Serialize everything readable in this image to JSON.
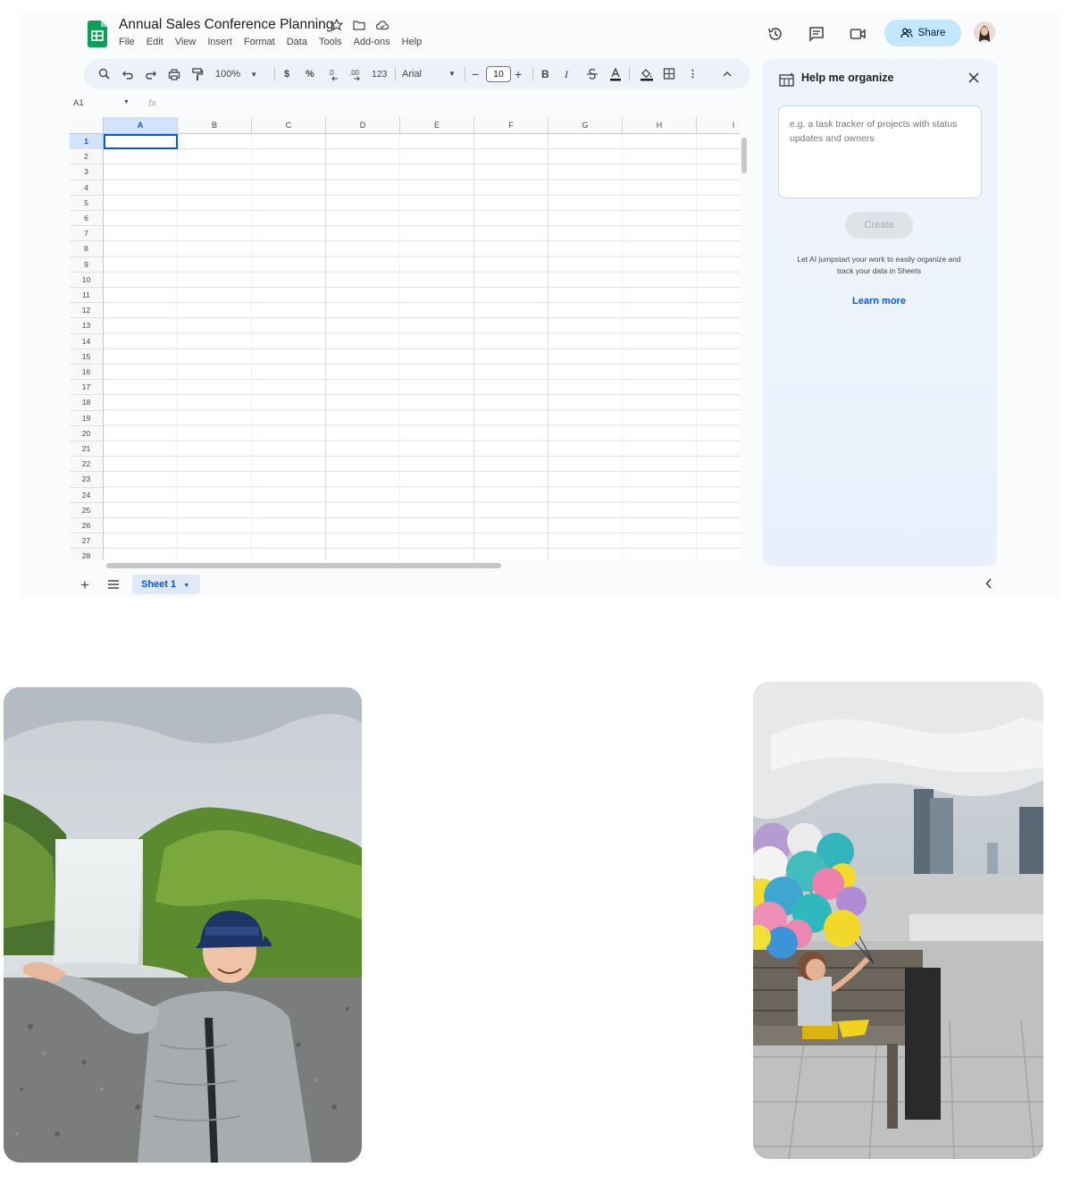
{
  "doc": {
    "title": "Annual Sales Conference Planning",
    "menu": [
      "File",
      "Edit",
      "View",
      "Insert",
      "Format",
      "Data",
      "Tools",
      "Add-ons",
      "Help"
    ]
  },
  "header": {
    "share_label": "Share",
    "icons": [
      "history-icon",
      "comment-icon",
      "meet-video-icon",
      "avatar"
    ]
  },
  "toolbar": {
    "zoom": "100%",
    "currency": "$",
    "percent": "%",
    "number_format": "123",
    "font": "Arial",
    "font_size": "10",
    "bold": "B",
    "italic": "I"
  },
  "namebox": {
    "cell": "A1",
    "fx": "fx"
  },
  "grid": {
    "columns": [
      "A",
      "B",
      "C",
      "D",
      "E",
      "F",
      "G",
      "H",
      "I"
    ],
    "rows": [
      "1",
      "2",
      "3",
      "4",
      "5",
      "6",
      "7",
      "8",
      "9",
      "10",
      "11",
      "12",
      "13",
      "14",
      "15",
      "16",
      "17",
      "18",
      "19",
      "20",
      "21",
      "22",
      "23",
      "24",
      "25",
      "26",
      "27",
      "28"
    ],
    "selected_cell": "A1"
  },
  "sheets": {
    "tabs": [
      "Sheet 1"
    ]
  },
  "panel": {
    "title": "Help me organize",
    "placeholder": "e.g. a task tracker of projects with status updates and owners",
    "create_label": "Create",
    "description": "Let AI jumpstart your work to easily organize and track your data in Sheets",
    "learn_more": "Learn more"
  },
  "colors": {
    "accent": "#0b57d0",
    "share_bg": "#c2e7ff",
    "sheets_green": "#0f9d58"
  }
}
